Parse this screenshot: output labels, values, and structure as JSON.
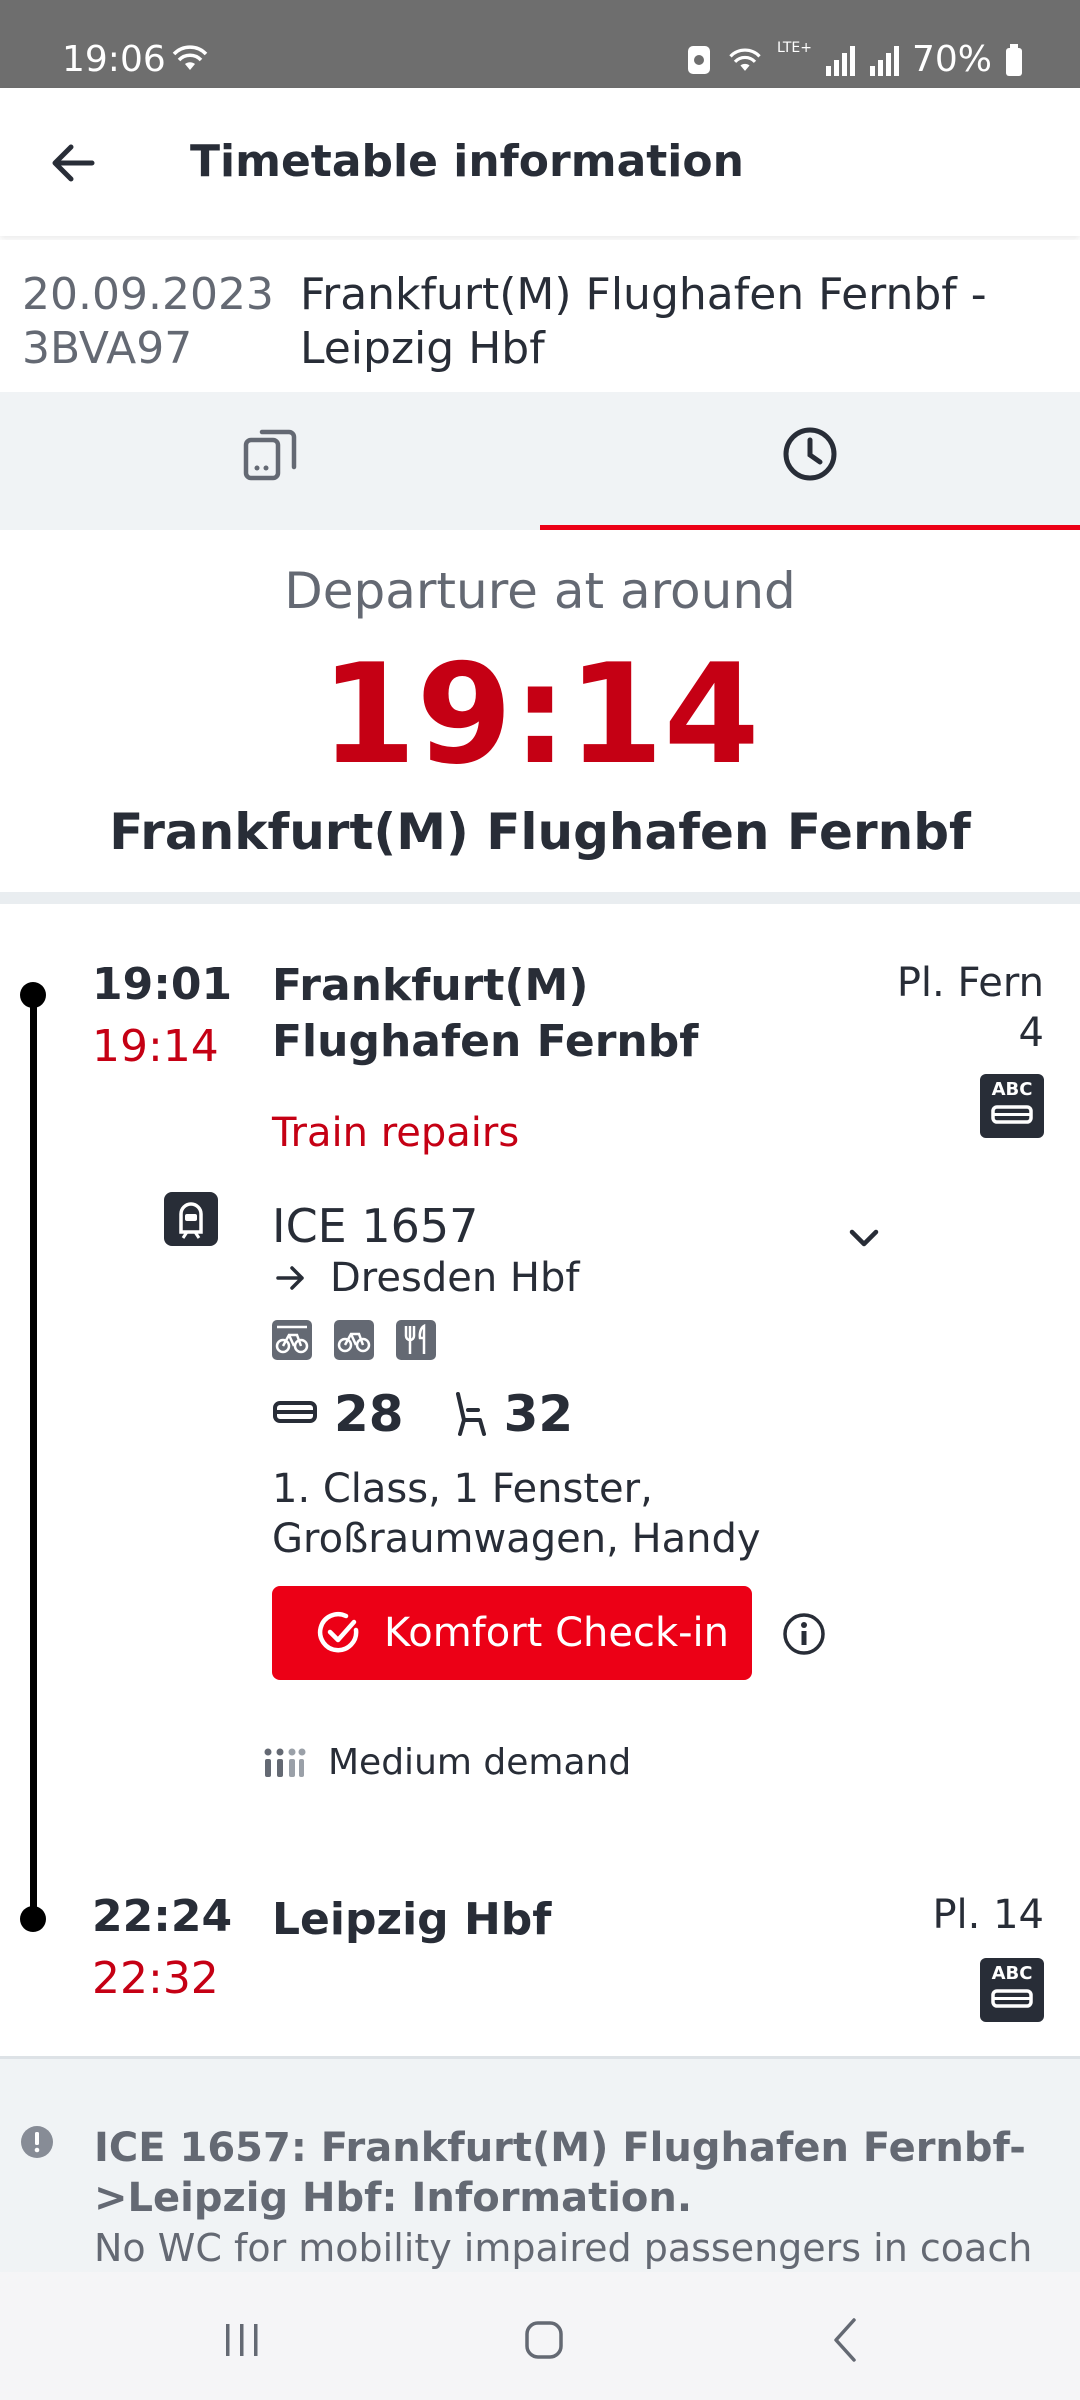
{
  "status_bar": {
    "time": "19:06",
    "network_label": "LTE+",
    "battery": "70%"
  },
  "app_bar": {
    "title": "Timetable information",
    "back_icon": "arrow-left-icon"
  },
  "journey": {
    "date": "20.09.2023",
    "code": "3BVA97",
    "route": "Frankfurt(M) Flughafen Fernbf - Leipzig Hbf"
  },
  "tabs": [
    {
      "icon": "seat-reservation-icon",
      "active": false
    },
    {
      "icon": "clock-icon",
      "active": true
    }
  ],
  "departure": {
    "label": "Departure at around",
    "time": "19:14",
    "station": "Frankfurt(M) Flughafen Fernbf"
  },
  "origin": {
    "scheduled": "19:01",
    "realtime": "19:14",
    "station": "Frankfurt(M) Flughafen Fernbf",
    "platform": "Pl. Fern 4",
    "abc": "ABC",
    "message": "Train repairs"
  },
  "train": {
    "name": "ICE 1657",
    "destination": "Dresden Hbf",
    "amenities": [
      "bicycle-reservation-icon",
      "bicycle-icon",
      "restaurant-icon"
    ],
    "coach": "28",
    "seat": "32",
    "seat_description": "1. Class, 1 Fenster, Großraumwagen, Handy",
    "checkin_label": "Komfort Check-in",
    "demand": "Medium demand"
  },
  "destination_stop": {
    "scheduled": "22:24",
    "realtime": "22:32",
    "station": "Leipzig Hbf",
    "platform": "Pl. 14",
    "abc": "ABC"
  },
  "notice": {
    "title": "ICE 1657: Frankfurt(M) Flughafen Fernbf->Leipzig Hbf: Information.",
    "body": "No WC for mobility impaired passengers in coach"
  },
  "colors": {
    "accent": "#ec0016",
    "realtime": "#c50014",
    "text": "#282d37",
    "muted": "#646973"
  }
}
